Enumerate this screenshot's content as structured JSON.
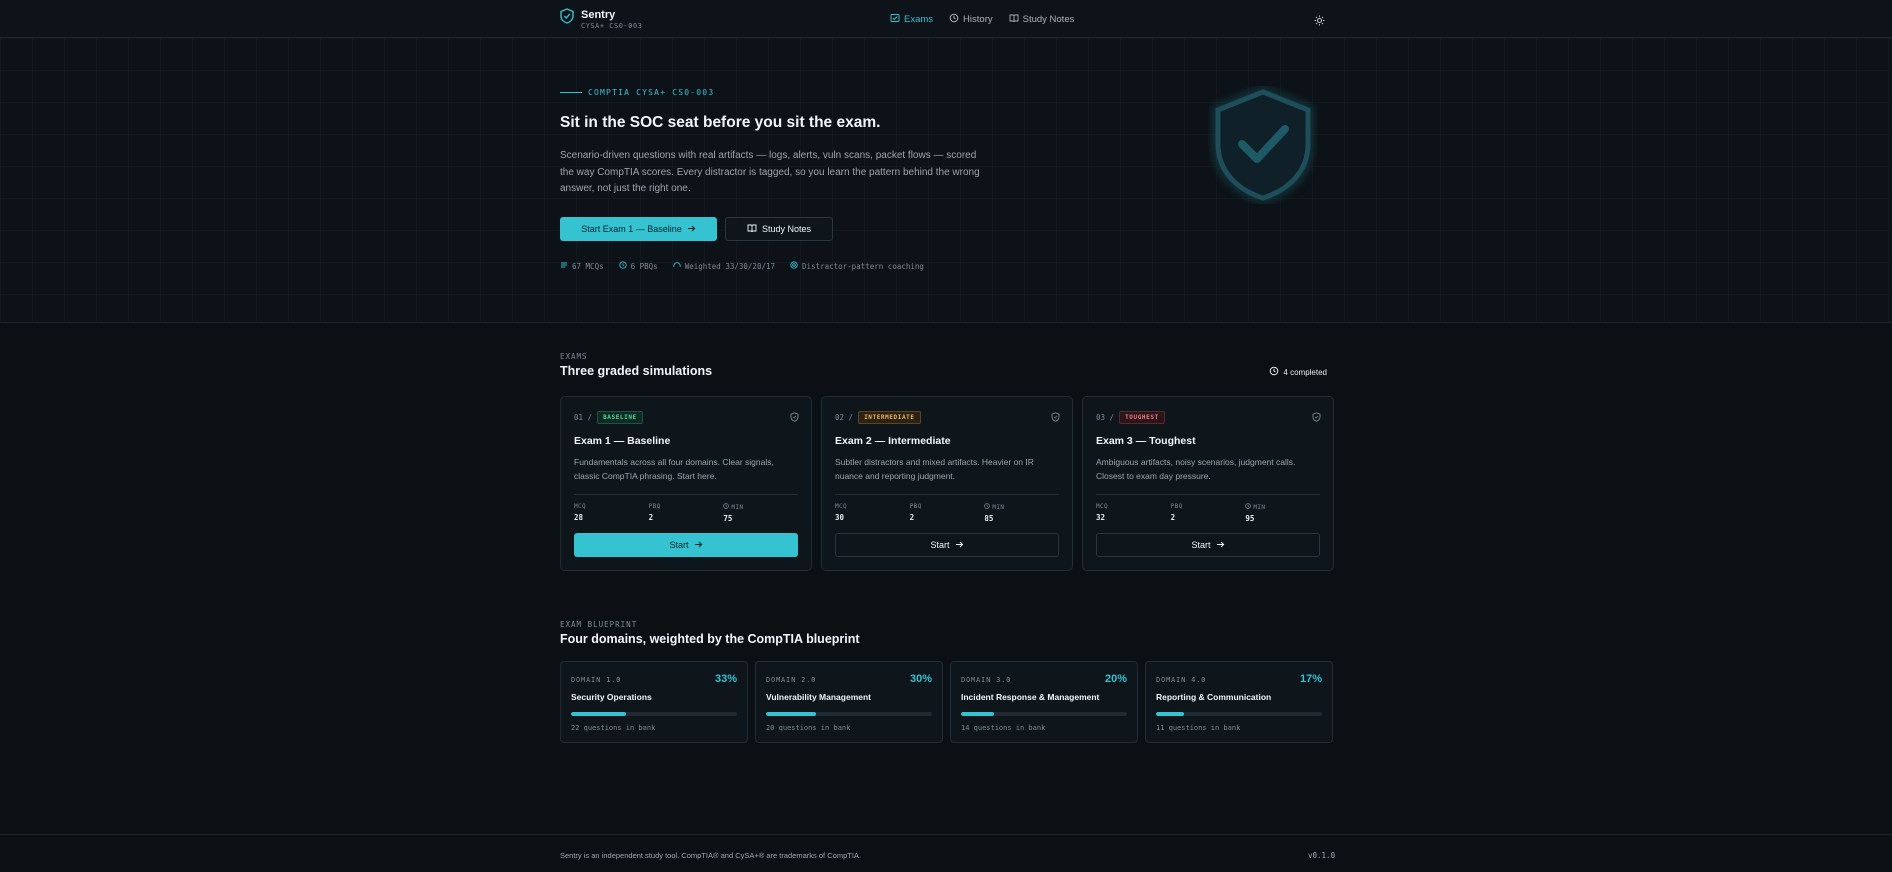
{
  "header": {
    "brand_name": "Sentry",
    "brand_sub": "CYSA+ CS0-003",
    "nav": [
      {
        "label": "Exams",
        "icon": "exam-icon",
        "active": true
      },
      {
        "label": "History",
        "icon": "history-icon",
        "active": false
      },
      {
        "label": "Study Notes",
        "icon": "book-icon",
        "active": false
      }
    ],
    "theme_icon": "sun-icon"
  },
  "hero": {
    "eyebrow": "COMPTIA CYSA+ CS0-003",
    "title": "Sit in the SOC seat before you sit the exam.",
    "description": "Scenario-driven questions with real artifacts — logs, alerts, vuln scans, packet flows — scored the way CompTIA scores. Every distractor is tagged, so you learn the pattern behind the wrong answer, not just the right one.",
    "primary_button": "Start Exam 1 — Baseline",
    "secondary_button": "Study Notes",
    "stats": [
      "67 MCQs",
      "6 PBQs",
      "Weighted 33/30/20/17",
      "Distractor-pattern coaching"
    ]
  },
  "exams": {
    "eyebrow": "EXAMS",
    "title": "Three graded simulations",
    "completed": "4 completed",
    "cards": [
      {
        "num": "01 /",
        "tag": "BASELINE",
        "title": "Exam 1 — Baseline",
        "desc": "Fundamentals across all four domains. Clear signals, classic CompTIA phrasing. Start here.",
        "mcq_label": "MCQ",
        "mcq": "28",
        "pbq_label": "PBQ",
        "pbq": "2",
        "min_label": "MIN",
        "min": "75",
        "button": "Start"
      },
      {
        "num": "02 /",
        "tag": "INTERMEDIATE",
        "title": "Exam 2 — Intermediate",
        "desc": "Subtler distractors and mixed artifacts. Heavier on IR nuance and reporting judgment.",
        "mcq_label": "MCQ",
        "mcq": "30",
        "pbq_label": "PBQ",
        "pbq": "2",
        "min_label": "MIN",
        "min": "85",
        "button": "Start"
      },
      {
        "num": "03 /",
        "tag": "TOUGHEST",
        "title": "Exam 3 — Toughest",
        "desc": "Ambiguous artifacts, noisy scenarios, judgment calls. Closest to exam day pressure.",
        "mcq_label": "MCQ",
        "mcq": "32",
        "pbq_label": "PBQ",
        "pbq": "2",
        "min_label": "MIN",
        "min": "95",
        "button": "Start"
      }
    ]
  },
  "blueprint": {
    "eyebrow": "EXAM BLUEPRINT",
    "title": "Four domains, weighted by the CompTIA blueprint",
    "domains": [
      {
        "label": "DOMAIN 1.0",
        "pct": "33%",
        "name": "Security Operations",
        "count": "22 questions in bank",
        "weight": 0.33
      },
      {
        "label": "DOMAIN 2.0",
        "pct": "30%",
        "name": "Vulnerability Management",
        "count": "20 questions in bank",
        "weight": 0.3
      },
      {
        "label": "DOMAIN 3.0",
        "pct": "20%",
        "name": "Incident Response & Management",
        "count": "14 questions in bank",
        "weight": 0.2
      },
      {
        "label": "DOMAIN 4.0",
        "pct": "17%",
        "name": "Reporting & Communication",
        "count": "11 questions in bank",
        "weight": 0.17
      }
    ]
  },
  "footer": {
    "note": "Sentry is an independent study tool. CompTIA® and CySA+® are trademarks of CompTIA.",
    "version": "v0.1.0"
  },
  "colors": {
    "accent": "#35c2d1",
    "background": "#0b1015",
    "card": "#0e151b",
    "baseline": "#4fd69a",
    "intermediate": "#f0b45c",
    "toughest": "#f07a8a"
  }
}
